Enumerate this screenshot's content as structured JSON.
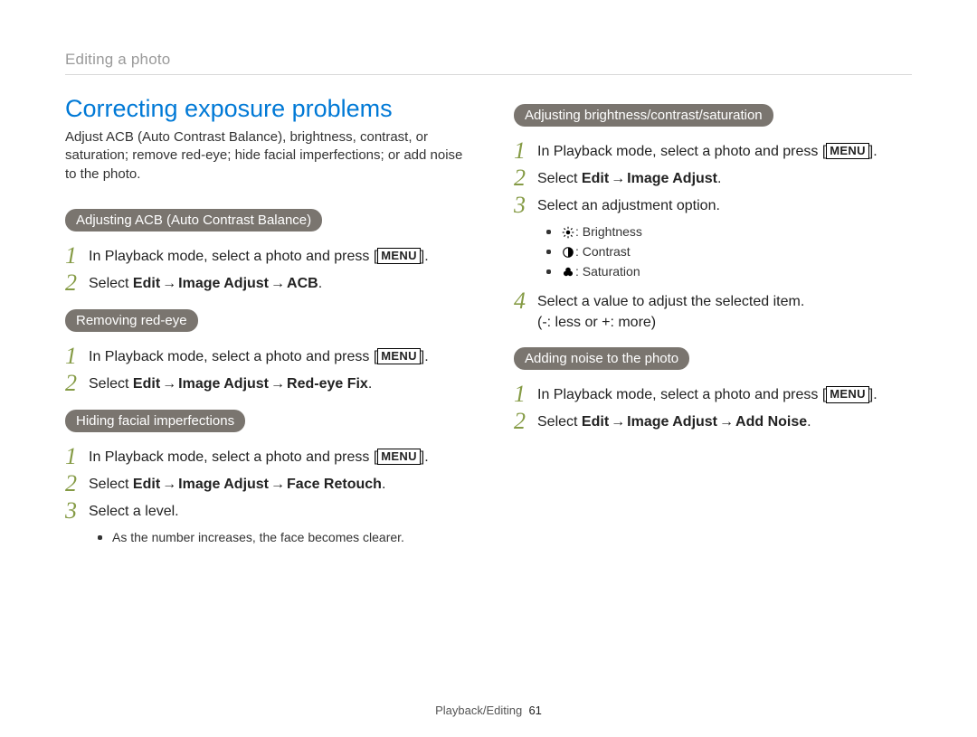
{
  "breadcrumb": "Editing a photo",
  "title": "Correcting exposure problems",
  "intro": "Adjust ACB (Auto Contrast Balance), brightness, contrast, or saturation; remove red-eye; hide facial imperfections; or add noise to the photo.",
  "menu_label": "MENU",
  "arrow_glyph": "→",
  "left": {
    "sections": [
      {
        "heading": "Adjusting ACB (Auto Contrast Balance)",
        "steps": [
          {
            "pre": "In Playback mode, select a photo and press [",
            "menu": true,
            "post": "]."
          },
          {
            "parts": [
              "Select ",
              "Edit",
              " → ",
              "Image Adjust",
              " → ",
              "ACB",
              "."
            ],
            "bold_idx": [
              1,
              3,
              5
            ]
          }
        ]
      },
      {
        "heading": "Removing red-eye",
        "steps": [
          {
            "pre": "In Playback mode, select a photo and press [",
            "menu": true,
            "post": "]."
          },
          {
            "parts": [
              "Select ",
              "Edit",
              " → ",
              "Image Adjust",
              " → ",
              "Red-eye Fix",
              "."
            ],
            "bold_idx": [
              1,
              3,
              5
            ]
          }
        ]
      },
      {
        "heading": "Hiding facial imperfections",
        "steps": [
          {
            "pre": "In Playback mode, select a photo and press [",
            "menu": true,
            "post": "]."
          },
          {
            "parts": [
              "Select ",
              "Edit",
              " → ",
              "Image Adjust",
              " → ",
              "Face Retouch",
              "."
            ],
            "bold_idx": [
              1,
              3,
              5
            ]
          },
          {
            "text": "Select a level."
          }
        ],
        "bullets": [
          "As the number increases, the face becomes clearer."
        ]
      }
    ]
  },
  "right": {
    "sections": [
      {
        "heading": "Adjusting brightness/contrast/saturation",
        "steps": [
          {
            "pre": "In Playback mode, select a photo and press [",
            "menu": true,
            "post": "]."
          },
          {
            "parts": [
              "Select ",
              "Edit",
              " → ",
              "Image Adjust",
              "."
            ],
            "bold_idx": [
              1,
              3
            ]
          },
          {
            "text": "Select an adjustment option.",
            "icon_bullets": [
              {
                "icon": "brightness-icon",
                "label": ": Brightness"
              },
              {
                "icon": "contrast-icon",
                "label": ": Contrast"
              },
              {
                "icon": "saturation-icon",
                "label": ": Saturation"
              }
            ]
          },
          {
            "text": "Select a value to adjust the selected item.",
            "subtext": "(-: less or +: more)"
          }
        ]
      },
      {
        "heading": "Adding noise to the photo",
        "steps": [
          {
            "pre": "In Playback mode, select a photo and press [",
            "menu": true,
            "post": "]."
          },
          {
            "parts": [
              "Select ",
              "Edit",
              " → ",
              "Image Adjust",
              " → ",
              "Add Noise",
              "."
            ],
            "bold_idx": [
              1,
              3,
              5
            ]
          }
        ]
      }
    ]
  },
  "footer": {
    "section": "Playback/Editing",
    "page": "61"
  }
}
